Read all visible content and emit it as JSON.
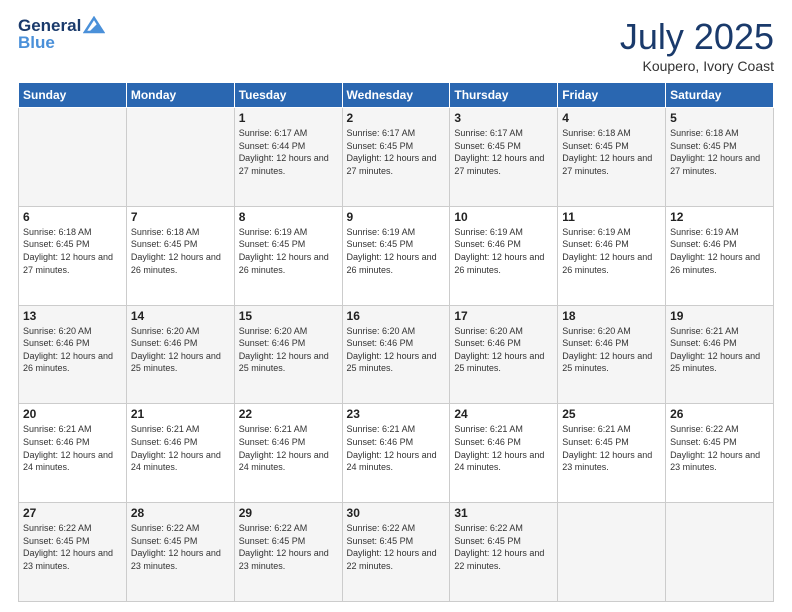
{
  "logo": {
    "line1": "General",
    "line2": "Blue"
  },
  "title": "July 2025",
  "subtitle": "Koupero, Ivory Coast",
  "days_header": [
    "Sunday",
    "Monday",
    "Tuesday",
    "Wednesday",
    "Thursday",
    "Friday",
    "Saturday"
  ],
  "weeks": [
    [
      {
        "day": "",
        "info": ""
      },
      {
        "day": "",
        "info": ""
      },
      {
        "day": "1",
        "sunrise": "6:17 AM",
        "sunset": "6:44 PM",
        "daylight": "12 hours and 27 minutes."
      },
      {
        "day": "2",
        "sunrise": "6:17 AM",
        "sunset": "6:45 PM",
        "daylight": "12 hours and 27 minutes."
      },
      {
        "day": "3",
        "sunrise": "6:17 AM",
        "sunset": "6:45 PM",
        "daylight": "12 hours and 27 minutes."
      },
      {
        "day": "4",
        "sunrise": "6:18 AM",
        "sunset": "6:45 PM",
        "daylight": "12 hours and 27 minutes."
      },
      {
        "day": "5",
        "sunrise": "6:18 AM",
        "sunset": "6:45 PM",
        "daylight": "12 hours and 27 minutes."
      }
    ],
    [
      {
        "day": "6",
        "sunrise": "6:18 AM",
        "sunset": "6:45 PM",
        "daylight": "12 hours and 27 minutes."
      },
      {
        "day": "7",
        "sunrise": "6:18 AM",
        "sunset": "6:45 PM",
        "daylight": "12 hours and 26 minutes."
      },
      {
        "day": "8",
        "sunrise": "6:19 AM",
        "sunset": "6:45 PM",
        "daylight": "12 hours and 26 minutes."
      },
      {
        "day": "9",
        "sunrise": "6:19 AM",
        "sunset": "6:45 PM",
        "daylight": "12 hours and 26 minutes."
      },
      {
        "day": "10",
        "sunrise": "6:19 AM",
        "sunset": "6:46 PM",
        "daylight": "12 hours and 26 minutes."
      },
      {
        "day": "11",
        "sunrise": "6:19 AM",
        "sunset": "6:46 PM",
        "daylight": "12 hours and 26 minutes."
      },
      {
        "day": "12",
        "sunrise": "6:19 AM",
        "sunset": "6:46 PM",
        "daylight": "12 hours and 26 minutes."
      }
    ],
    [
      {
        "day": "13",
        "sunrise": "6:20 AM",
        "sunset": "6:46 PM",
        "daylight": "12 hours and 26 minutes."
      },
      {
        "day": "14",
        "sunrise": "6:20 AM",
        "sunset": "6:46 PM",
        "daylight": "12 hours and 25 minutes."
      },
      {
        "day": "15",
        "sunrise": "6:20 AM",
        "sunset": "6:46 PM",
        "daylight": "12 hours and 25 minutes."
      },
      {
        "day": "16",
        "sunrise": "6:20 AM",
        "sunset": "6:46 PM",
        "daylight": "12 hours and 25 minutes."
      },
      {
        "day": "17",
        "sunrise": "6:20 AM",
        "sunset": "6:46 PM",
        "daylight": "12 hours and 25 minutes."
      },
      {
        "day": "18",
        "sunrise": "6:20 AM",
        "sunset": "6:46 PM",
        "daylight": "12 hours and 25 minutes."
      },
      {
        "day": "19",
        "sunrise": "6:21 AM",
        "sunset": "6:46 PM",
        "daylight": "12 hours and 25 minutes."
      }
    ],
    [
      {
        "day": "20",
        "sunrise": "6:21 AM",
        "sunset": "6:46 PM",
        "daylight": "12 hours and 24 minutes."
      },
      {
        "day": "21",
        "sunrise": "6:21 AM",
        "sunset": "6:46 PM",
        "daylight": "12 hours and 24 minutes."
      },
      {
        "day": "22",
        "sunrise": "6:21 AM",
        "sunset": "6:46 PM",
        "daylight": "12 hours and 24 minutes."
      },
      {
        "day": "23",
        "sunrise": "6:21 AM",
        "sunset": "6:46 PM",
        "daylight": "12 hours and 24 minutes."
      },
      {
        "day": "24",
        "sunrise": "6:21 AM",
        "sunset": "6:46 PM",
        "daylight": "12 hours and 24 minutes."
      },
      {
        "day": "25",
        "sunrise": "6:21 AM",
        "sunset": "6:45 PM",
        "daylight": "12 hours and 23 minutes."
      },
      {
        "day": "26",
        "sunrise": "6:22 AM",
        "sunset": "6:45 PM",
        "daylight": "12 hours and 23 minutes."
      }
    ],
    [
      {
        "day": "27",
        "sunrise": "6:22 AM",
        "sunset": "6:45 PM",
        "daylight": "12 hours and 23 minutes."
      },
      {
        "day": "28",
        "sunrise": "6:22 AM",
        "sunset": "6:45 PM",
        "daylight": "12 hours and 23 minutes."
      },
      {
        "day": "29",
        "sunrise": "6:22 AM",
        "sunset": "6:45 PM",
        "daylight": "12 hours and 23 minutes."
      },
      {
        "day": "30",
        "sunrise": "6:22 AM",
        "sunset": "6:45 PM",
        "daylight": "12 hours and 22 minutes."
      },
      {
        "day": "31",
        "sunrise": "6:22 AM",
        "sunset": "6:45 PM",
        "daylight": "12 hours and 22 minutes."
      },
      {
        "day": "",
        "info": ""
      },
      {
        "day": "",
        "info": ""
      }
    ]
  ]
}
